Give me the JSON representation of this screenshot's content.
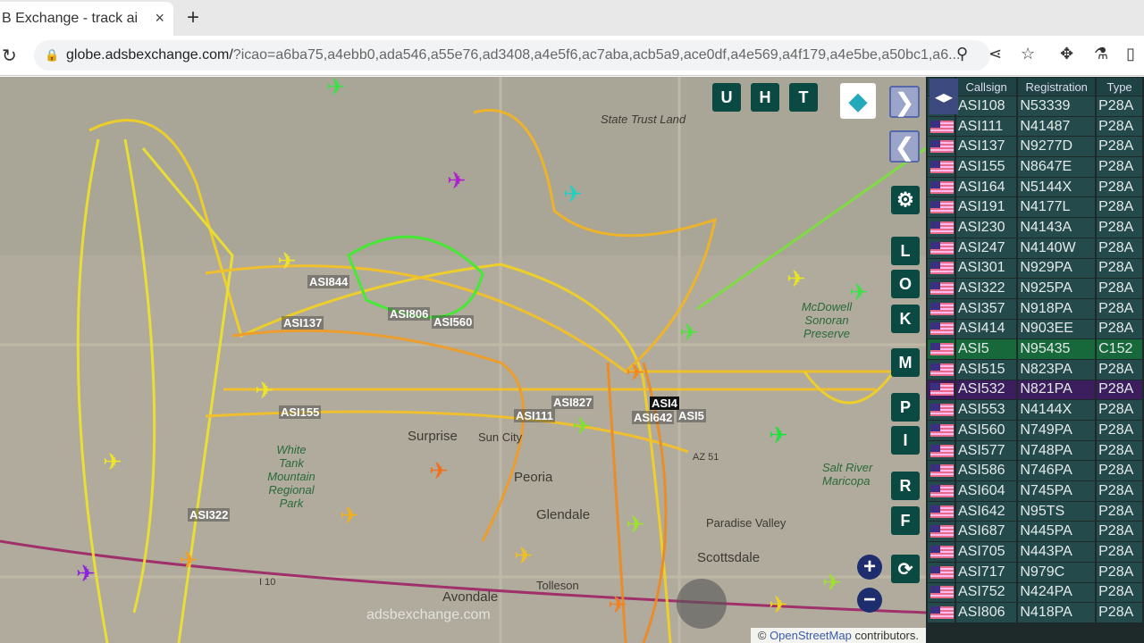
{
  "browser": {
    "tab_title": "B Exchange - track ai",
    "close": "×",
    "new_tab": "+",
    "url_host": "globe.adsbexchange.com/",
    "url_query": "?icao=a6ba75,a4ebb0,ada546,a55e76,ad3408,a4e5f6,ac7aba,acb5a9,ace0df,a4e569,a4f179,a4e5be,a50bc1,a6..."
  },
  "map": {
    "places": [
      "State Trust Land",
      "Surprise",
      "Sun City",
      "Peoria",
      "Glendale",
      "Avondale",
      "Tolleson",
      "Scottsdale",
      "White Tank Mountain Regional Park",
      "McDowell Sonoran Preserve",
      "Paradise Valley",
      "Salt River Maricopa",
      "AZ 51",
      "I 10"
    ],
    "callsign_labels": [
      "ASI844",
      "ASI137",
      "ASI806",
      "ASI560",
      "ASI155",
      "ASI111",
      "ASI827",
      "ASI642",
      "ASI322",
      "ASI4",
      "ASI5"
    ],
    "buttons_top": [
      "U",
      "H",
      "T"
    ],
    "buttons_side": [
      "L",
      "O",
      "K",
      "M",
      "P",
      "I",
      "R",
      "F"
    ],
    "watermark": "adsbexchange.com",
    "attribution_prefix": "©",
    "attribution_link": "OpenStreetMap",
    "attribution_suffix": " contributors."
  },
  "table": {
    "headers": [
      "Callsign",
      "Registration",
      "Type"
    ],
    "rows": [
      [
        "ASI108",
        "N53339",
        "P28A"
      ],
      [
        "ASI111",
        "N41487",
        "P28A"
      ],
      [
        "ASI137",
        "N9277D",
        "P28A"
      ],
      [
        "ASI155",
        "N8647E",
        "P28A"
      ],
      [
        "ASI164",
        "N5144X",
        "P28A"
      ],
      [
        "ASI191",
        "N4177L",
        "P28A"
      ],
      [
        "ASI230",
        "N4143A",
        "P28A"
      ],
      [
        "ASI247",
        "N4140W",
        "P28A"
      ],
      [
        "ASI301",
        "N929PA",
        "P28A"
      ],
      [
        "ASI322",
        "N925PA",
        "P28A"
      ],
      [
        "ASI357",
        "N918PA",
        "P28A"
      ],
      [
        "ASI414",
        "N903EE",
        "P28A"
      ],
      [
        "ASI5",
        "N95435",
        "C152"
      ],
      [
        "ASI515",
        "N823PA",
        "P28A"
      ],
      [
        "ASI532",
        "N821PA",
        "P28A"
      ],
      [
        "ASI553",
        "N4144X",
        "P28A"
      ],
      [
        "ASI560",
        "N749PA",
        "P28A"
      ],
      [
        "ASI577",
        "N748PA",
        "P28A"
      ],
      [
        "ASI586",
        "N746PA",
        "P28A"
      ],
      [
        "ASI604",
        "N745PA",
        "P28A"
      ],
      [
        "ASI642",
        "N95TS",
        "P28A"
      ],
      [
        "ASI687",
        "N445PA",
        "P28A"
      ],
      [
        "ASI705",
        "N443PA",
        "P28A"
      ],
      [
        "ASI717",
        "N979C",
        "P28A"
      ],
      [
        "ASI752",
        "N424PA",
        "P28A"
      ],
      [
        "ASI806",
        "N418PA",
        "P28A"
      ]
    ],
    "highlight_green": "ASI5",
    "highlight_purple": "ASI532"
  }
}
